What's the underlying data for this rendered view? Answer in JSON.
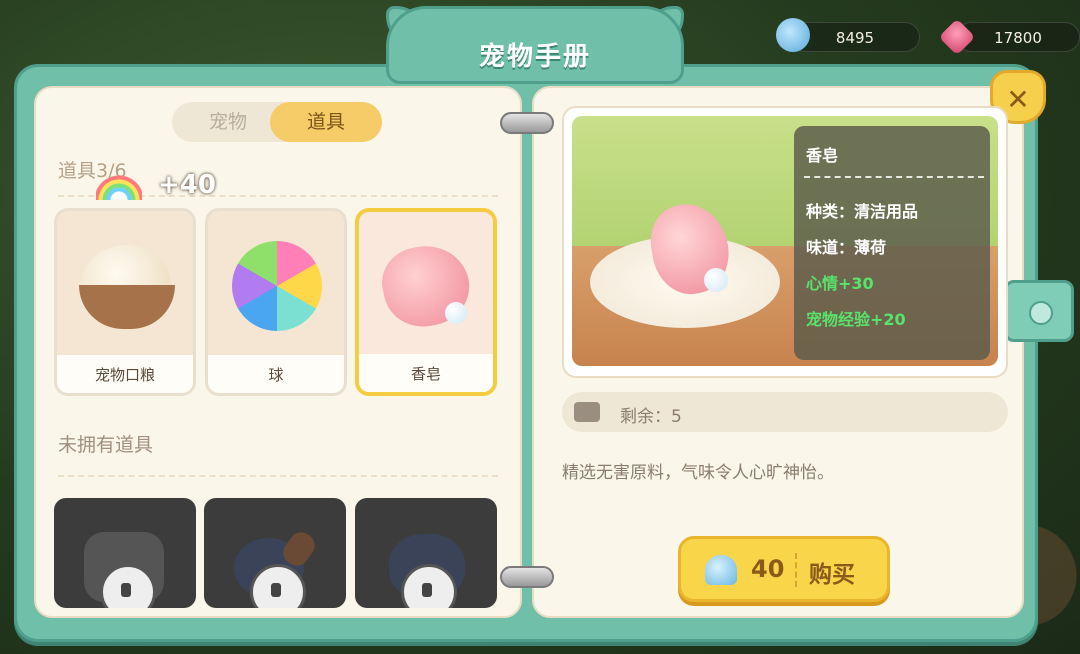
{
  "header": {
    "title": "宠物手册",
    "shell_currency": "8495",
    "gem_currency": "17800"
  },
  "tabs": [
    {
      "label": "宠物",
      "active": false
    },
    {
      "label": "道具",
      "active": true
    }
  ],
  "owned": {
    "section_title": "道具3/6",
    "rainbow_bonus": "+40",
    "items": [
      {
        "name": "宠物口粮",
        "icon": "egg-nest-icon"
      },
      {
        "name": "球",
        "icon": "beach-ball-icon"
      },
      {
        "name": "香皂",
        "icon": "soap-icon",
        "selected": true
      }
    ]
  },
  "unowned": {
    "section_title": "未拥有道具",
    "items": [
      {
        "icon": "cushion-icon",
        "locked": true
      },
      {
        "icon": "brush-icon",
        "locked": true
      },
      {
        "icon": "cat-toy-icon",
        "locked": true
      }
    ]
  },
  "detail": {
    "name": "香皂",
    "category": "种类：清洁用品",
    "flavor": "味道：薄荷",
    "mood": "心情+30",
    "exp": "宠物经验+20",
    "remaining": "剩余：5",
    "description": "精选无害原料，气味令人心旷神怡。",
    "price": "40",
    "buy_label": "购买"
  },
  "colors": {
    "teal": "#6fbfa9",
    "gold": "#f5cc3f",
    "stat_green": "#58e36a"
  }
}
